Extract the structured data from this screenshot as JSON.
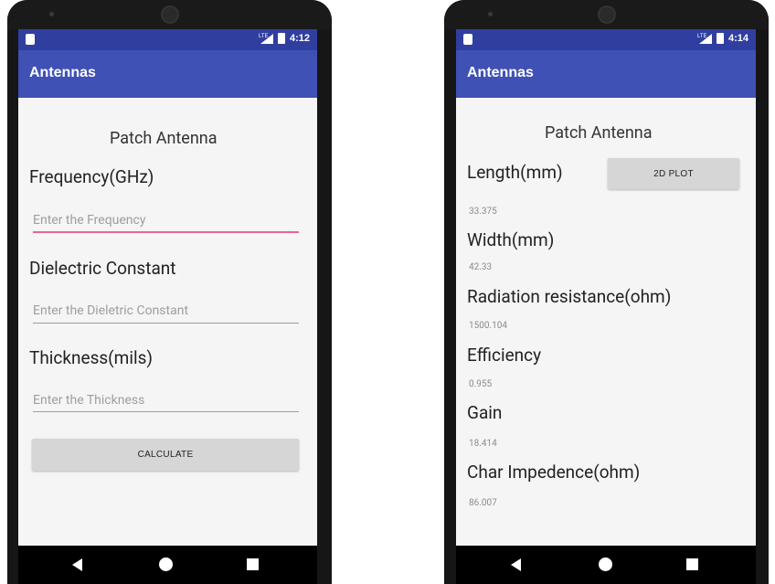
{
  "screens": [
    {
      "statusbar": {
        "time": "4:12",
        "network": "LTE"
      },
      "app_title": "Antennas",
      "heading": "Patch Antenna",
      "fields": [
        {
          "label": "Frequency(GHz)",
          "placeholder": "Enter the Frequency"
        },
        {
          "label": "Dielectric Constant",
          "placeholder": "Enter the Dieletric Constant"
        },
        {
          "label": "Thickness(mils)",
          "placeholder": "Enter the Thickness"
        }
      ],
      "calculate_label": "CALCULATE"
    },
    {
      "statusbar": {
        "time": "4:14",
        "network": "LTE"
      },
      "app_title": "Antennas",
      "heading": "Patch Antenna",
      "plot_button_label": "2D PLOT",
      "results": [
        {
          "label": "Length(mm)",
          "value": "33.375"
        },
        {
          "label": "Width(mm)",
          "value": "42.33"
        },
        {
          "label": "Radiation resistance(ohm)",
          "value": "1500.104"
        },
        {
          "label": "Efficiency",
          "value": "0.955"
        },
        {
          "label": "Gain",
          "value": "18.414"
        },
        {
          "label": "Char Impedence(ohm)",
          "value": "86.007"
        }
      ]
    }
  ],
  "colors": {
    "statusbar": "#303f9f",
    "appbar": "#3f51b5",
    "focus_underline": "#f06292",
    "button": "#d6d6d6"
  }
}
